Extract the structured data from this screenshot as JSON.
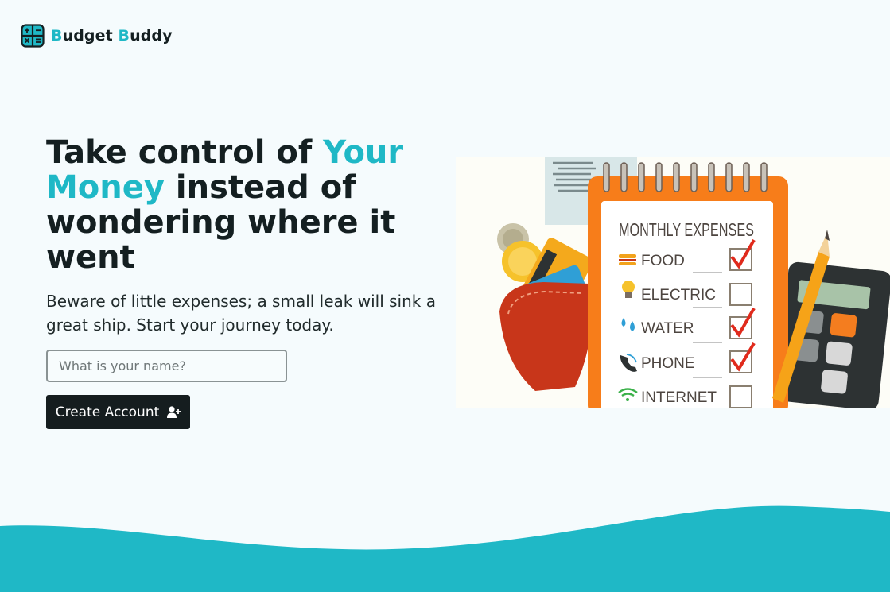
{
  "brand": {
    "name_part1_initial": "B",
    "name_part1_rest": "udget ",
    "name_part2_initial": "B",
    "name_part2_rest": "uddy",
    "logo_icon": "calculator-icon"
  },
  "hero": {
    "title_part1": "Take control of ",
    "title_highlight": "Your Money",
    "title_part2": " instead of wondering where it went",
    "subtitle": "Beware of little expenses; a small leak will sink a great ship. Start your journey today."
  },
  "signup": {
    "name_placeholder": "What is your name?",
    "name_value": "",
    "create_button_label": "Create Account",
    "create_button_icon": "user-plus-icon"
  },
  "illustration": {
    "heading": "MONTHLY EXPENSES",
    "items": [
      {
        "label": "FOOD",
        "icon": "burger-icon",
        "checked": true
      },
      {
        "label": "ELECTRIC",
        "icon": "lightbulb-icon",
        "checked": false
      },
      {
        "label": "WATER",
        "icon": "water-drops-icon",
        "checked": true
      },
      {
        "label": "PHONE",
        "icon": "phone-icon",
        "checked": true
      },
      {
        "label": "INTERNET",
        "icon": "wifi-icon",
        "checked": false
      }
    ]
  },
  "colors": {
    "accent": "#1fb8c6",
    "dark": "#151d1f",
    "background": "#f5fbfd",
    "notepad_orange": "#f77d1a"
  }
}
